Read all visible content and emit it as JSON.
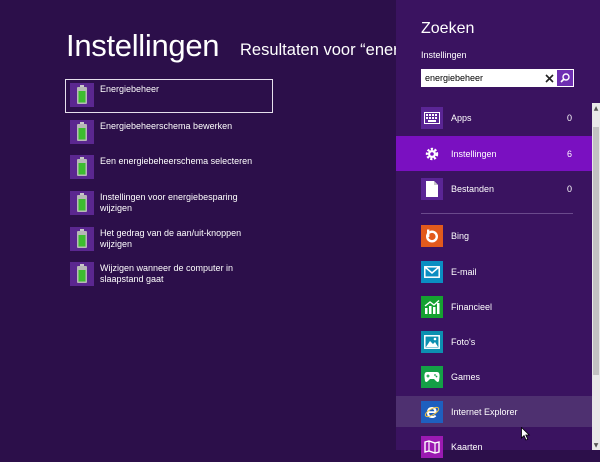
{
  "main": {
    "title": "Instellingen",
    "results_heading": "Resultaten voor “energiebeheer”",
    "results": [
      {
        "label": "Energiebeheer",
        "icon": "battery-icon"
      },
      {
        "label": "Energiebeheerschema bewerken",
        "icon": "battery-icon"
      },
      {
        "label": "Een energiebeheerschema selecteren",
        "icon": "battery-icon"
      },
      {
        "label": "Instellingen voor energiebesparing wijzigen",
        "icon": "battery-icon"
      },
      {
        "label": "Het gedrag van de aan/uit-knoppen wijzigen",
        "icon": "battery-icon"
      },
      {
        "label": "Wijzigen wanneer de computer in slaapstand gaat",
        "icon": "battery-icon"
      }
    ]
  },
  "search": {
    "title": "Zoeken",
    "scope": "Instellingen",
    "query": "energiebeheer",
    "categories": [
      {
        "label": "Apps",
        "count": "0",
        "icon": "apps-keyboard-icon"
      },
      {
        "label": "Instellingen",
        "count": "6",
        "icon": "gear-icon"
      },
      {
        "label": "Bestanden",
        "count": "0",
        "icon": "file-icon"
      }
    ],
    "apps": [
      {
        "label": "Bing",
        "icon": "bing-icon",
        "color": "#e25a1c"
      },
      {
        "label": "E-mail",
        "icon": "mail-icon",
        "color": "#0a8ec2"
      },
      {
        "label": "Financieel",
        "icon": "finance-icon",
        "color": "#15a130"
      },
      {
        "label": "Foto's",
        "icon": "photos-icon",
        "color": "#0c8fb0"
      },
      {
        "label": "Games",
        "icon": "games-icon",
        "color": "#14a046"
      },
      {
        "label": "Internet Explorer",
        "icon": "internet-explorer-icon",
        "color": "#1e5fbf"
      },
      {
        "label": "Kaarten",
        "icon": "maps-icon",
        "color": "#9b1ab2"
      }
    ]
  },
  "colors": {
    "background": "#2c0f4a",
    "pane": "#3a1360",
    "accent": "#7a10c1"
  }
}
